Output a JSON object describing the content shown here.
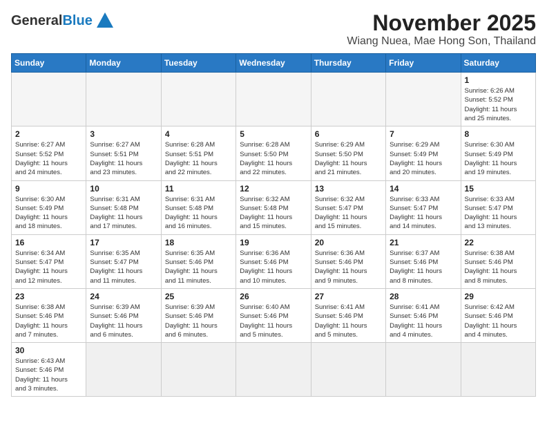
{
  "header": {
    "logo_general": "General",
    "logo_blue": "Blue",
    "month_title": "November 2025",
    "location": "Wiang Nuea, Mae Hong Son, Thailand"
  },
  "weekdays": [
    "Sunday",
    "Monday",
    "Tuesday",
    "Wednesday",
    "Thursday",
    "Friday",
    "Saturday"
  ],
  "weeks": [
    [
      {
        "day": "",
        "info": ""
      },
      {
        "day": "",
        "info": ""
      },
      {
        "day": "",
        "info": ""
      },
      {
        "day": "",
        "info": ""
      },
      {
        "day": "",
        "info": ""
      },
      {
        "day": "",
        "info": ""
      },
      {
        "day": "1",
        "info": "Sunrise: 6:26 AM\nSunset: 5:52 PM\nDaylight: 11 hours\nand 25 minutes."
      }
    ],
    [
      {
        "day": "2",
        "info": "Sunrise: 6:27 AM\nSunset: 5:52 PM\nDaylight: 11 hours\nand 24 minutes."
      },
      {
        "day": "3",
        "info": "Sunrise: 6:27 AM\nSunset: 5:51 PM\nDaylight: 11 hours\nand 23 minutes."
      },
      {
        "day": "4",
        "info": "Sunrise: 6:28 AM\nSunset: 5:51 PM\nDaylight: 11 hours\nand 22 minutes."
      },
      {
        "day": "5",
        "info": "Sunrise: 6:28 AM\nSunset: 5:50 PM\nDaylight: 11 hours\nand 22 minutes."
      },
      {
        "day": "6",
        "info": "Sunrise: 6:29 AM\nSunset: 5:50 PM\nDaylight: 11 hours\nand 21 minutes."
      },
      {
        "day": "7",
        "info": "Sunrise: 6:29 AM\nSunset: 5:49 PM\nDaylight: 11 hours\nand 20 minutes."
      },
      {
        "day": "8",
        "info": "Sunrise: 6:30 AM\nSunset: 5:49 PM\nDaylight: 11 hours\nand 19 minutes."
      }
    ],
    [
      {
        "day": "9",
        "info": "Sunrise: 6:30 AM\nSunset: 5:49 PM\nDaylight: 11 hours\nand 18 minutes."
      },
      {
        "day": "10",
        "info": "Sunrise: 6:31 AM\nSunset: 5:48 PM\nDaylight: 11 hours\nand 17 minutes."
      },
      {
        "day": "11",
        "info": "Sunrise: 6:31 AM\nSunset: 5:48 PM\nDaylight: 11 hours\nand 16 minutes."
      },
      {
        "day": "12",
        "info": "Sunrise: 6:32 AM\nSunset: 5:48 PM\nDaylight: 11 hours\nand 15 minutes."
      },
      {
        "day": "13",
        "info": "Sunrise: 6:32 AM\nSunset: 5:47 PM\nDaylight: 11 hours\nand 15 minutes."
      },
      {
        "day": "14",
        "info": "Sunrise: 6:33 AM\nSunset: 5:47 PM\nDaylight: 11 hours\nand 14 minutes."
      },
      {
        "day": "15",
        "info": "Sunrise: 6:33 AM\nSunset: 5:47 PM\nDaylight: 11 hours\nand 13 minutes."
      }
    ],
    [
      {
        "day": "16",
        "info": "Sunrise: 6:34 AM\nSunset: 5:47 PM\nDaylight: 11 hours\nand 12 minutes."
      },
      {
        "day": "17",
        "info": "Sunrise: 6:35 AM\nSunset: 5:47 PM\nDaylight: 11 hours\nand 11 minutes."
      },
      {
        "day": "18",
        "info": "Sunrise: 6:35 AM\nSunset: 5:46 PM\nDaylight: 11 hours\nand 11 minutes."
      },
      {
        "day": "19",
        "info": "Sunrise: 6:36 AM\nSunset: 5:46 PM\nDaylight: 11 hours\nand 10 minutes."
      },
      {
        "day": "20",
        "info": "Sunrise: 6:36 AM\nSunset: 5:46 PM\nDaylight: 11 hours\nand 9 minutes."
      },
      {
        "day": "21",
        "info": "Sunrise: 6:37 AM\nSunset: 5:46 PM\nDaylight: 11 hours\nand 8 minutes."
      },
      {
        "day": "22",
        "info": "Sunrise: 6:38 AM\nSunset: 5:46 PM\nDaylight: 11 hours\nand 8 minutes."
      }
    ],
    [
      {
        "day": "23",
        "info": "Sunrise: 6:38 AM\nSunset: 5:46 PM\nDaylight: 11 hours\nand 7 minutes."
      },
      {
        "day": "24",
        "info": "Sunrise: 6:39 AM\nSunset: 5:46 PM\nDaylight: 11 hours\nand 6 minutes."
      },
      {
        "day": "25",
        "info": "Sunrise: 6:39 AM\nSunset: 5:46 PM\nDaylight: 11 hours\nand 6 minutes."
      },
      {
        "day": "26",
        "info": "Sunrise: 6:40 AM\nSunset: 5:46 PM\nDaylight: 11 hours\nand 5 minutes."
      },
      {
        "day": "27",
        "info": "Sunrise: 6:41 AM\nSunset: 5:46 PM\nDaylight: 11 hours\nand 5 minutes."
      },
      {
        "day": "28",
        "info": "Sunrise: 6:41 AM\nSunset: 5:46 PM\nDaylight: 11 hours\nand 4 minutes."
      },
      {
        "day": "29",
        "info": "Sunrise: 6:42 AM\nSunset: 5:46 PM\nDaylight: 11 hours\nand 4 minutes."
      }
    ],
    [
      {
        "day": "30",
        "info": "Sunrise: 6:43 AM\nSunset: 5:46 PM\nDaylight: 11 hours\nand 3 minutes."
      },
      {
        "day": "",
        "info": ""
      },
      {
        "day": "",
        "info": ""
      },
      {
        "day": "",
        "info": ""
      },
      {
        "day": "",
        "info": ""
      },
      {
        "day": "",
        "info": ""
      },
      {
        "day": "",
        "info": ""
      }
    ]
  ]
}
